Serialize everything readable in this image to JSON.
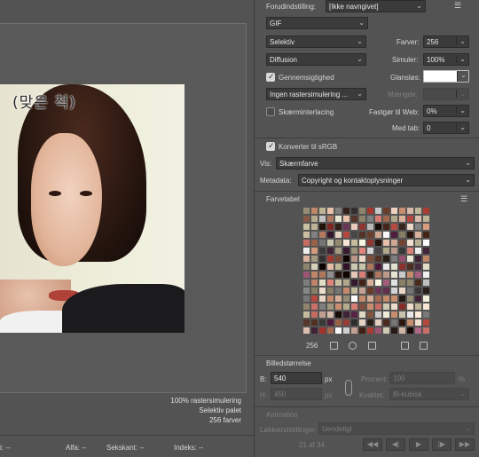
{
  "preview": {
    "subtitle": "(맞은 척)",
    "status_lines": [
      "100% rastersimulering",
      "Selektiv palet",
      "256 farver"
    ]
  },
  "bottom_bar": {
    "r_label": "i: --",
    "alfa_label": "Alfa: --",
    "sekskant_label": "Sekskant: --",
    "indeks_label": "Indeks: --"
  },
  "settings": {
    "preset_label": "Forudindstilling:",
    "preset_value": "[Ikke navngivet]",
    "format": "GIF",
    "reduction": "Selektiv",
    "dither_method": "Diffusion",
    "colors_label": "Farver:",
    "colors_value": "256",
    "dither_label": "Simuler:",
    "dither_value": "100%",
    "transparency_label": "Gennemsigtighed",
    "transparency_checked": true,
    "matte_label": "Glansløs:",
    "matte_color": "#ffffff",
    "transparency_dither": "Ingen rastersimulering ...",
    "amount_label": "Mængde:",
    "interlaced_label": "Skærminterlacing",
    "interlaced_checked": false,
    "websnap_label": "Fastgør til Web:",
    "websnap_value": "0%",
    "lossy_label": "Med tab:",
    "lossy_value": "0",
    "srgb_label": "Konverter til sRGB",
    "srgb_checked": true,
    "view_label": "Vis:",
    "view_value": "Skærmfarve",
    "metadata_label": "Metadata:",
    "metadata_value": "Copyright og kontaktoplysninger"
  },
  "color_table": {
    "title": "Farvetabel",
    "count": "256"
  },
  "image_size": {
    "title": "Billedstørrelse",
    "width_label": "B:",
    "width_value": "540",
    "height_label": "H:",
    "height_value": "450",
    "unit": "px",
    "percent_label": "Procent:",
    "percent_value": "100",
    "percent_unit": "%",
    "quality_label": "Kvalitet:",
    "quality_value": "Bi-kubisk"
  },
  "animation": {
    "title": "Animation",
    "loop_label": "Løkkeindstillinger:",
    "loop_value": "Uendeligt",
    "frame_counter": "21 af 34"
  }
}
